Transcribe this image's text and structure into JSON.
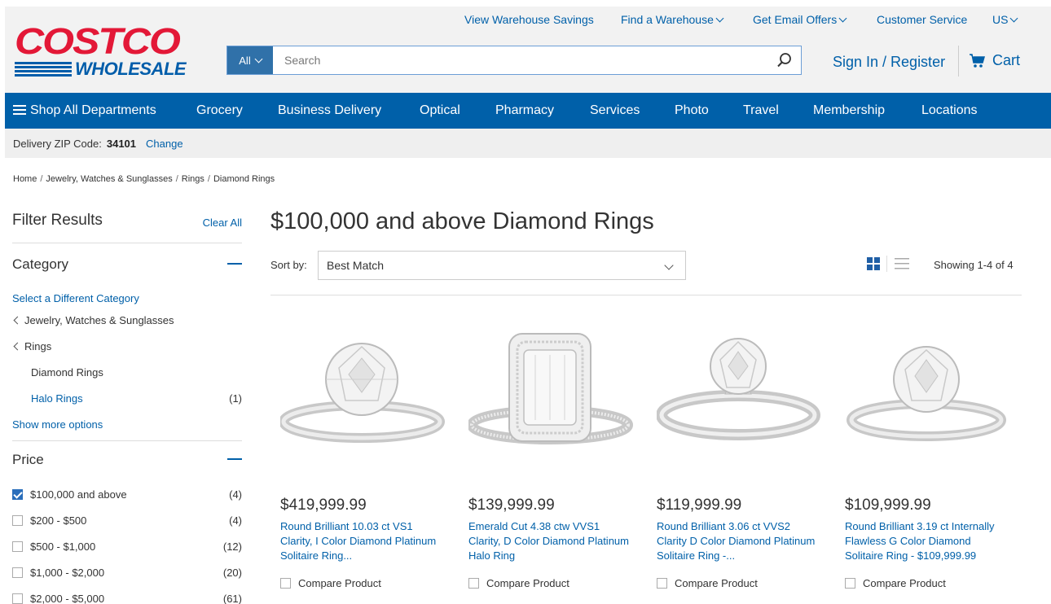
{
  "brand": {
    "logo_top": "COSTCO",
    "logo_bottom": "WHOLESALE",
    "red": "#e31837",
    "blue": "#005daa"
  },
  "top_links": {
    "savings": "View Warehouse Savings",
    "find": "Find a Warehouse",
    "email": "Get Email Offers",
    "service": "Customer Service",
    "country": "US"
  },
  "search": {
    "scope": "All",
    "placeholder": "Search"
  },
  "account": {
    "signin": "Sign In / Register",
    "cart": "Cart"
  },
  "nav": {
    "shop_all": "Shop All Departments",
    "items": [
      "Grocery",
      "Business Delivery",
      "Optical",
      "Pharmacy",
      "Services",
      "Photo",
      "Travel",
      "Membership",
      "Locations"
    ]
  },
  "zip": {
    "label": "Delivery ZIP Code:",
    "code": "34101",
    "change": "Change"
  },
  "breadcrumb": [
    "Home",
    "Jewelry, Watches & Sunglasses",
    "Rings",
    "Diamond Rings"
  ],
  "filters": {
    "title": "Filter Results",
    "clear": "Clear All",
    "category": {
      "heading": "Category",
      "select_different": "Select a Different Category",
      "parent1": "Jewelry, Watches & Sunglasses",
      "parent2": "Rings",
      "current": "Diamond Rings",
      "child": {
        "label": "Halo Rings",
        "count": "(1)"
      },
      "more": "Show more options"
    },
    "price": {
      "heading": "Price",
      "options": [
        {
          "label": "$100,000 and above",
          "count": "(4)",
          "checked": true
        },
        {
          "label": "$200 - $500",
          "count": "(4)",
          "checked": false
        },
        {
          "label": "$500 - $1,000",
          "count": "(12)",
          "checked": false
        },
        {
          "label": "$1,000 - $2,000",
          "count": "(20)",
          "checked": false
        },
        {
          "label": "$2,000 - $5,000",
          "count": "(61)",
          "checked": false
        }
      ]
    }
  },
  "main": {
    "title": "$100,000 and above Diamond Rings",
    "sort_label": "Sort by:",
    "sort_value": "Best Match",
    "showing": "Showing 1-4 of 4"
  },
  "products": [
    {
      "price": "$419,999.99",
      "name": "Round Brilliant 10.03 ct VS1 Clarity, I Color Diamond Platinum Solitaire Ring...",
      "compare": "Compare Product"
    },
    {
      "price": "$139,999.99",
      "name": "Emerald Cut 4.38 ctw VVS1 Clarity, D Color Diamond Platinum Halo Ring",
      "compare": "Compare Product"
    },
    {
      "price": "$119,999.99",
      "name": "Round Brilliant 3.06 ct VVS2 Clarity D Color Diamond Platinum Solitaire Ring -...",
      "compare": "Compare Product"
    },
    {
      "price": "$109,999.99",
      "name": "Round Brilliant 3.19 ct Internally Flawless G Color Diamond Solitaire Ring - $109,999.99",
      "compare": "Compare Product"
    }
  ]
}
